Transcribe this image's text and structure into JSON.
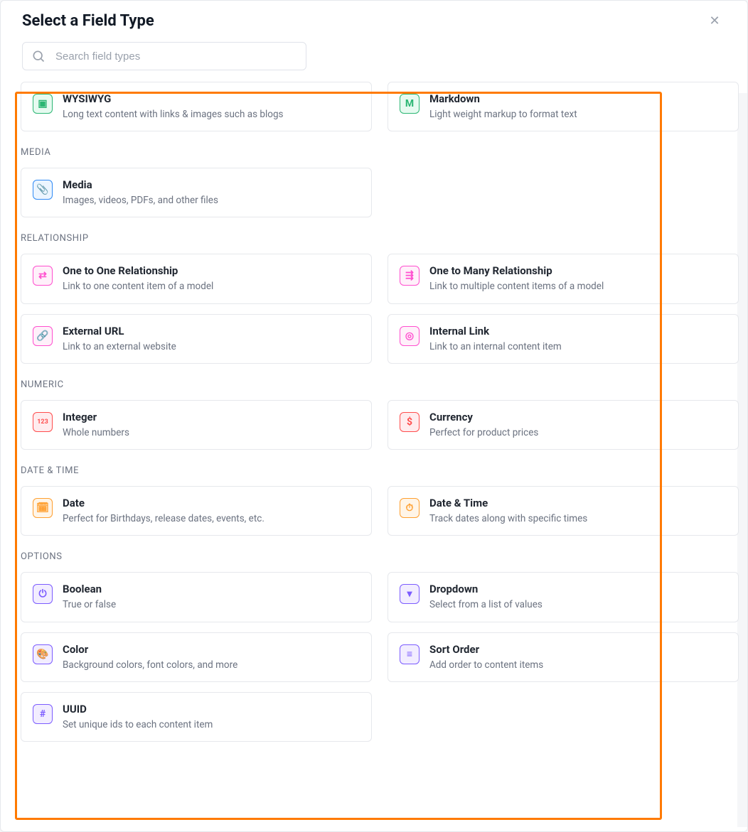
{
  "header": {
    "title": "Select a Field Type"
  },
  "search": {
    "placeholder": "Search field types"
  },
  "groups": [
    {
      "id": "text",
      "label": "",
      "cards": [
        {
          "id": "wysiwyg",
          "title": "WYSIWYG",
          "subtitle": "Long text content with links & images such as blogs",
          "icon": "wysiwyg-icon",
          "glyph": "▣",
          "theme": "th-green"
        },
        {
          "id": "markdown",
          "title": "Markdown",
          "subtitle": "Light weight markup to format text",
          "icon": "markdown-icon",
          "glyph": "M",
          "theme": "th-green"
        }
      ]
    },
    {
      "id": "media",
      "label": "MEDIA",
      "cards": [
        {
          "id": "media",
          "title": "Media",
          "subtitle": "Images, videos, PDFs, and other files",
          "icon": "attachment-icon",
          "glyph": "📎",
          "theme": "th-blue"
        }
      ]
    },
    {
      "id": "relationship",
      "label": "RELATIONSHIP",
      "cards": [
        {
          "id": "one-to-one",
          "title": "One to One Relationship",
          "subtitle": "Link to one content item of a model",
          "icon": "one-to-one-icon",
          "glyph": "⇄",
          "theme": "th-pink"
        },
        {
          "id": "one-to-many",
          "title": "One to Many Relationship",
          "subtitle": "Link to multiple content items of a model",
          "icon": "one-to-many-icon",
          "glyph": "⇶",
          "theme": "th-pink"
        },
        {
          "id": "external-url",
          "title": "External URL",
          "subtitle": "Link to an external website",
          "icon": "link-icon",
          "glyph": "🔗",
          "theme": "th-pink"
        },
        {
          "id": "internal-link",
          "title": "Internal Link",
          "subtitle": "Link to an internal content item",
          "icon": "internal-link-icon",
          "glyph": "◎",
          "theme": "th-pink"
        }
      ]
    },
    {
      "id": "numeric",
      "label": "NUMERIC",
      "cards": [
        {
          "id": "integer",
          "title": "Integer",
          "subtitle": "Whole numbers",
          "icon": "integer-icon",
          "glyph": "123",
          "theme": "th-red"
        },
        {
          "id": "currency",
          "title": "Currency",
          "subtitle": "Perfect for product prices",
          "icon": "currency-icon",
          "glyph": "$",
          "theme": "th-red"
        }
      ]
    },
    {
      "id": "datetime",
      "label": "DATE & TIME",
      "cards": [
        {
          "id": "date",
          "title": "Date",
          "subtitle": "Perfect for Birthdays, release dates, events, etc.",
          "icon": "calendar-icon",
          "glyph": "🗓",
          "theme": "th-orange"
        },
        {
          "id": "date-time",
          "title": "Date & Time",
          "subtitle": "Track dates along with specific times",
          "icon": "clock-icon",
          "glyph": "⏱",
          "theme": "th-orange"
        }
      ]
    },
    {
      "id": "options",
      "label": "OPTIONS",
      "cards": [
        {
          "id": "boolean",
          "title": "Boolean",
          "subtitle": "True or false",
          "icon": "toggle-icon",
          "glyph": "⏻",
          "theme": "th-purple"
        },
        {
          "id": "dropdown",
          "title": "Dropdown",
          "subtitle": "Select from a list of values",
          "icon": "dropdown-icon",
          "glyph": "▾",
          "theme": "th-purple"
        },
        {
          "id": "color",
          "title": "Color",
          "subtitle": "Background colors, font colors, and more",
          "icon": "palette-icon",
          "glyph": "🎨",
          "theme": "th-purple"
        },
        {
          "id": "sort-order",
          "title": "Sort Order",
          "subtitle": "Add order to content items",
          "icon": "list-order-icon",
          "glyph": "≡",
          "theme": "th-purple"
        },
        {
          "id": "uuid",
          "title": "UUID",
          "subtitle": "Set unique ids to each content item",
          "icon": "hash-icon",
          "glyph": "#",
          "theme": "th-purple"
        }
      ]
    }
  ]
}
